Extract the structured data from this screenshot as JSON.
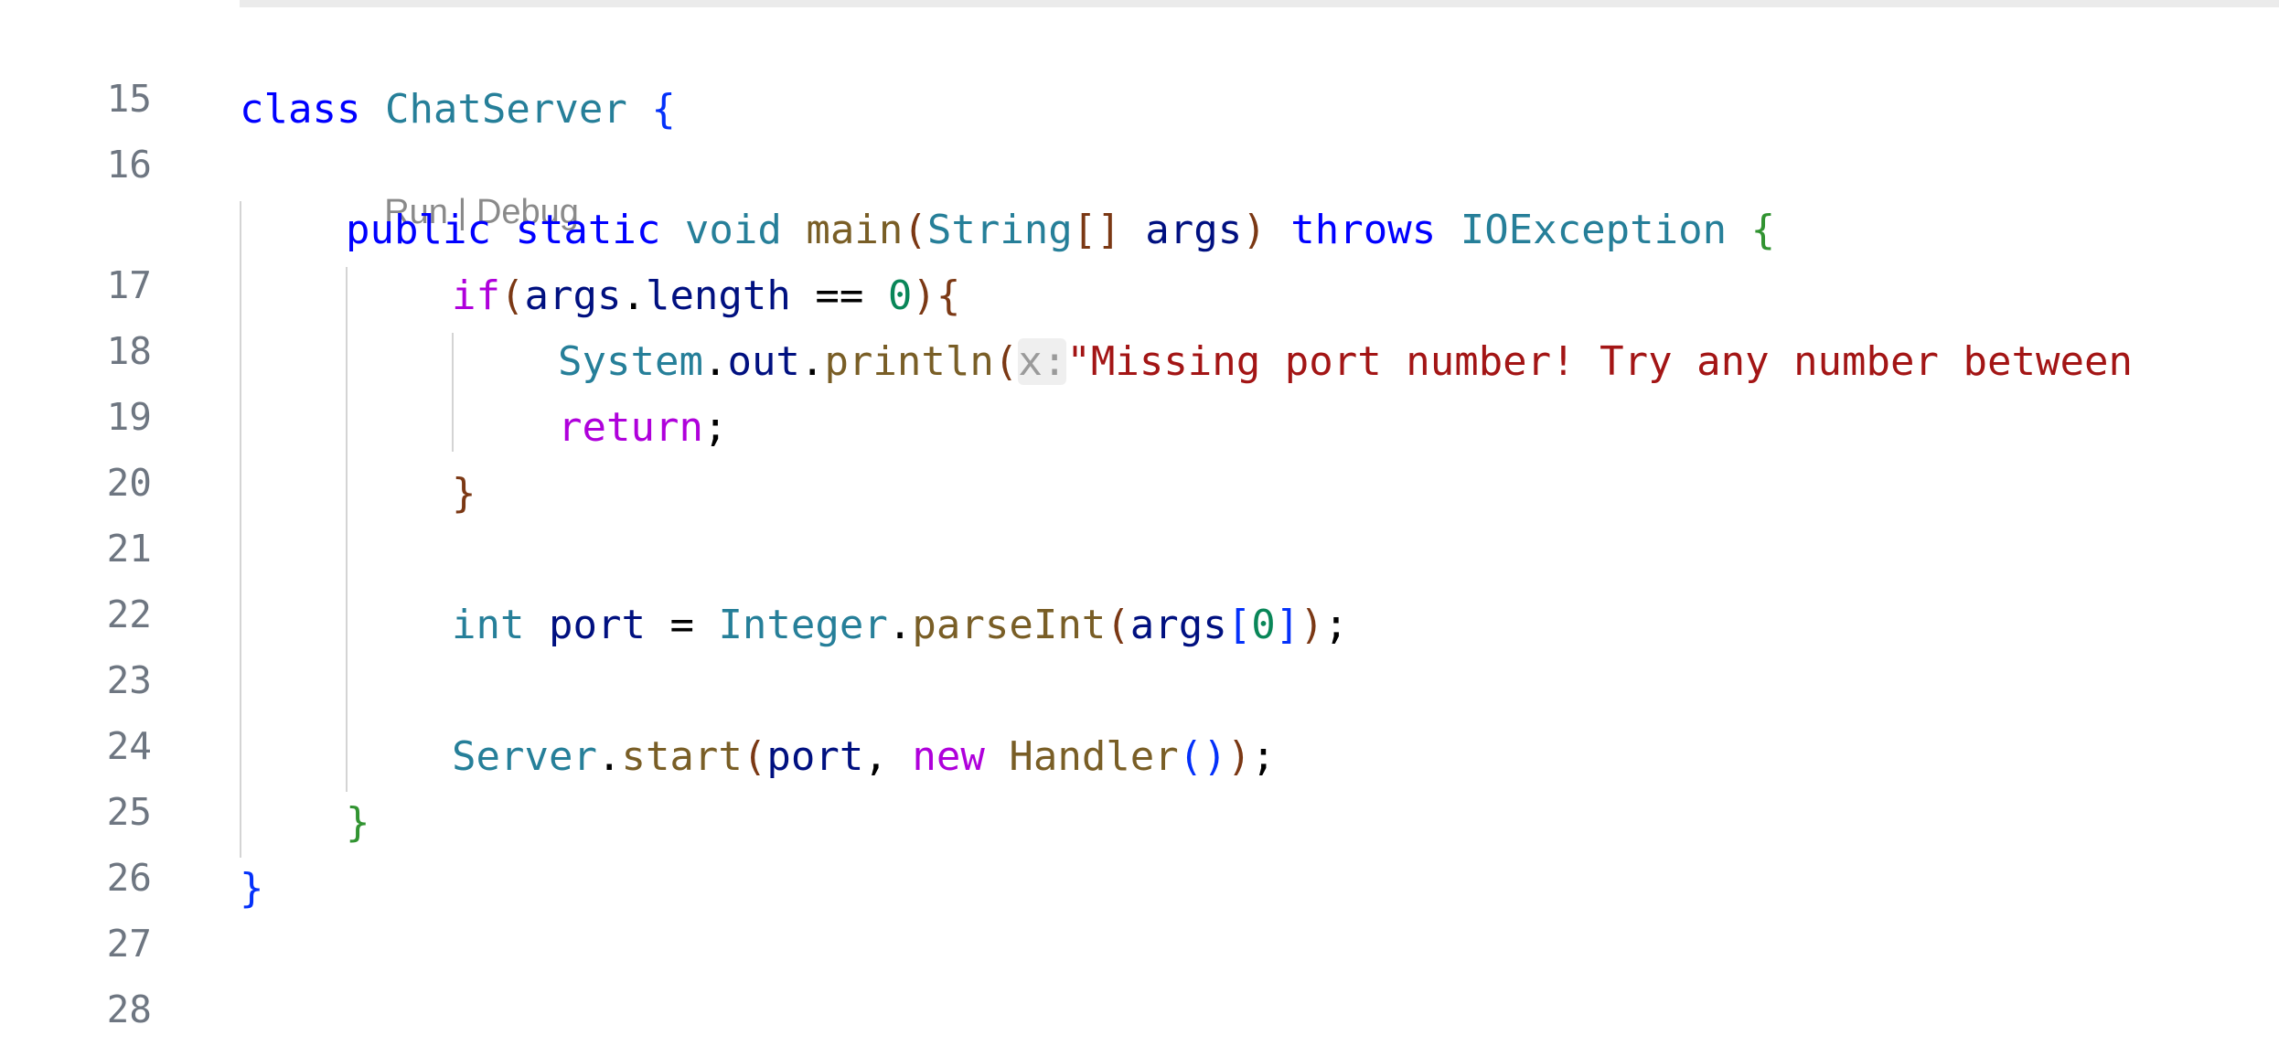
{
  "editor": {
    "codelens": {
      "run_label": "Run",
      "separator": " | ",
      "debug_label": "Debug"
    },
    "lines": [
      {
        "number": "15",
        "tokens": []
      },
      {
        "number": "16",
        "tokens": [
          "class",
          " ",
          "ChatServer",
          " ",
          "{"
        ]
      },
      {
        "number": "17",
        "tokens": [
          "public",
          " ",
          "static",
          " ",
          "void",
          " ",
          "main",
          "(",
          "String",
          "[]",
          " ",
          "args",
          ")",
          " ",
          "throws",
          " ",
          "IOException",
          " ",
          "{"
        ]
      },
      {
        "number": "18",
        "tokens": [
          "if",
          "(",
          "args",
          ".",
          "length",
          " == ",
          "0",
          ")",
          "{"
        ]
      },
      {
        "number": "19",
        "tokens": [
          "System",
          ".",
          "out",
          ".",
          "println",
          "(",
          "x:",
          "\"Missing port number! Try any number between"
        ]
      },
      {
        "number": "20",
        "tokens": [
          "return",
          ";"
        ]
      },
      {
        "number": "21",
        "tokens": [
          "}"
        ]
      },
      {
        "number": "22",
        "tokens": []
      },
      {
        "number": "23",
        "tokens": [
          "int",
          " ",
          "port",
          " = ",
          "Integer",
          ".",
          "parseInt",
          "(",
          "args",
          "[",
          "0",
          "]",
          ")",
          ";"
        ]
      },
      {
        "number": "24",
        "tokens": []
      },
      {
        "number": "25",
        "tokens": [
          "Server",
          ".",
          "start",
          "(",
          "port",
          ", ",
          "new",
          " ",
          "Handler",
          "()",
          ")",
          ";"
        ]
      },
      {
        "number": "26",
        "tokens": [
          "}"
        ]
      },
      {
        "number": "27",
        "tokens": [
          "}"
        ]
      },
      {
        "number": "28",
        "tokens": []
      }
    ]
  },
  "colors": {
    "keyword": "#0000ff",
    "type": "#267f99",
    "function": "#795e26",
    "variable": "#001080",
    "control": "#af00db",
    "string": "#a31515",
    "number": "#098658",
    "line_number": "#6e7681",
    "codelens": "#8a8a8a"
  }
}
